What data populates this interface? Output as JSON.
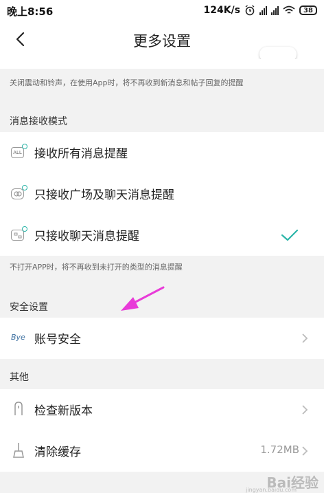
{
  "status_bar": {
    "time": "晚上8:56",
    "speed": "124K/s",
    "battery": "38"
  },
  "header": {
    "title": "更多设置"
  },
  "notes": {
    "vibrate_note": "关闭震动和铃声，在使用App时，将不再收到新消息和帖子回复的提醒",
    "mode_note": "不打开APP时，将不再收到未打开的类型的消息提醒"
  },
  "sections": {
    "receive_mode": "消息接收模式",
    "security": "安全设置",
    "other": "其他"
  },
  "receive_options": [
    {
      "label": "接收所有消息提醒",
      "icon": "all-messages-icon",
      "icon_text": "ALL",
      "selected": false
    },
    {
      "label": "只接收广场及聊天消息提醒",
      "icon": "square-chat-icon",
      "selected": false
    },
    {
      "label": "只接收聊天消息提醒",
      "icon": "chat-icon",
      "selected": true
    }
  ],
  "security_items": [
    {
      "label": "账号安全",
      "icon_text": "Bye"
    }
  ],
  "other_items": [
    {
      "label": "检查新版本",
      "icon": "update-icon"
    },
    {
      "label": "清除缓存",
      "icon": "broom-icon",
      "value": "1.72MB"
    }
  ],
  "colors": {
    "accent": "#2bb5a8",
    "arrow": "#e83bd8"
  },
  "watermark": {
    "text": "Bai经验",
    "sub": "jingyan.baidu.com"
  }
}
